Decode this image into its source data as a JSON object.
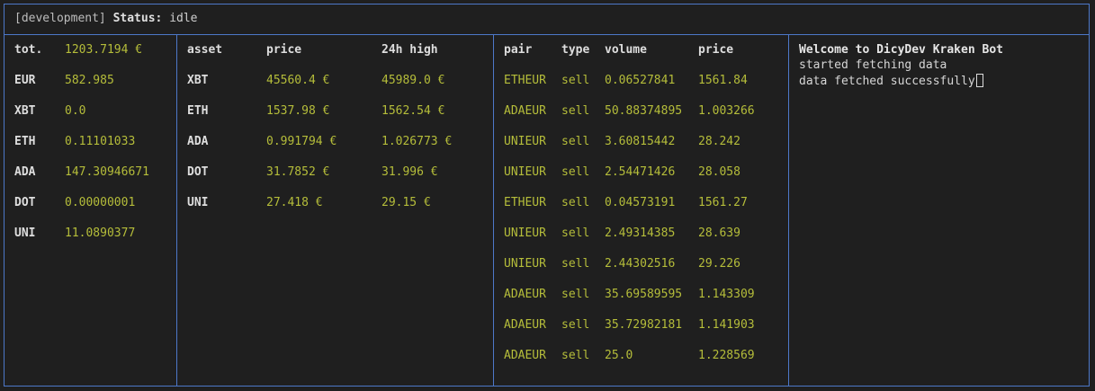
{
  "header": {
    "env": "[development]",
    "status_label": "Status:",
    "status_value": "idle"
  },
  "balance": {
    "rows": [
      {
        "label": "tot.",
        "value": "1203.7194 €"
      },
      {
        "label": "EUR",
        "value": "582.985"
      },
      {
        "label": "XBT",
        "value": "0.0"
      },
      {
        "label": "ETH",
        "value": "0.11101033"
      },
      {
        "label": "ADA",
        "value": "147.30946671"
      },
      {
        "label": "DOT",
        "value": "0.00000001"
      },
      {
        "label": "UNI",
        "value": "11.0890377"
      }
    ]
  },
  "assets": {
    "headers": [
      "asset",
      "price",
      "24h high"
    ],
    "rows": [
      {
        "asset": "XBT",
        "price": "45560.4 €",
        "high": "45989.0 €"
      },
      {
        "asset": "ETH",
        "price": "1537.98 €",
        "high": "1562.54 €"
      },
      {
        "asset": "ADA",
        "price": "0.991794 €",
        "high": "1.026773 €"
      },
      {
        "asset": "DOT",
        "price": "31.7852 €",
        "high": "31.996 €"
      },
      {
        "asset": "UNI",
        "price": "27.418 €",
        "high": "29.15 €"
      }
    ]
  },
  "trades": {
    "headers": [
      "pair",
      "type",
      "volume",
      "price"
    ],
    "rows": [
      {
        "pair": "ETHEUR",
        "type": "sell",
        "volume": "0.06527841",
        "price": "1561.84"
      },
      {
        "pair": "ADAEUR",
        "type": "sell",
        "volume": "50.88374895",
        "price": "1.003266"
      },
      {
        "pair": "UNIEUR",
        "type": "sell",
        "volume": "3.60815442",
        "price": "28.242"
      },
      {
        "pair": "UNIEUR",
        "type": "sell",
        "volume": "2.54471426",
        "price": "28.058"
      },
      {
        "pair": "ETHEUR",
        "type": "sell",
        "volume": "0.04573191",
        "price": "1561.27"
      },
      {
        "pair": "UNIEUR",
        "type": "sell",
        "volume": "2.49314385",
        "price": "28.639"
      },
      {
        "pair": "UNIEUR",
        "type": "sell",
        "volume": "2.44302516",
        "price": "29.226"
      },
      {
        "pair": "ADAEUR",
        "type": "sell",
        "volume": "35.69589595",
        "price": "1.143309"
      },
      {
        "pair": "ADAEUR",
        "type": "sell",
        "volume": "35.72982181",
        "price": "1.141903"
      },
      {
        "pair": "ADAEUR",
        "type": "sell",
        "volume": "25.0",
        "price": "1.228569"
      }
    ]
  },
  "log": {
    "title": "Welcome to DicyDev Kraken Bot",
    "lines": [
      "started fetching data",
      "data fetched successfully"
    ]
  },
  "colors": {
    "background": "#1f1f1f",
    "border": "#4d78c9",
    "value": "#b5bd3a"
  }
}
